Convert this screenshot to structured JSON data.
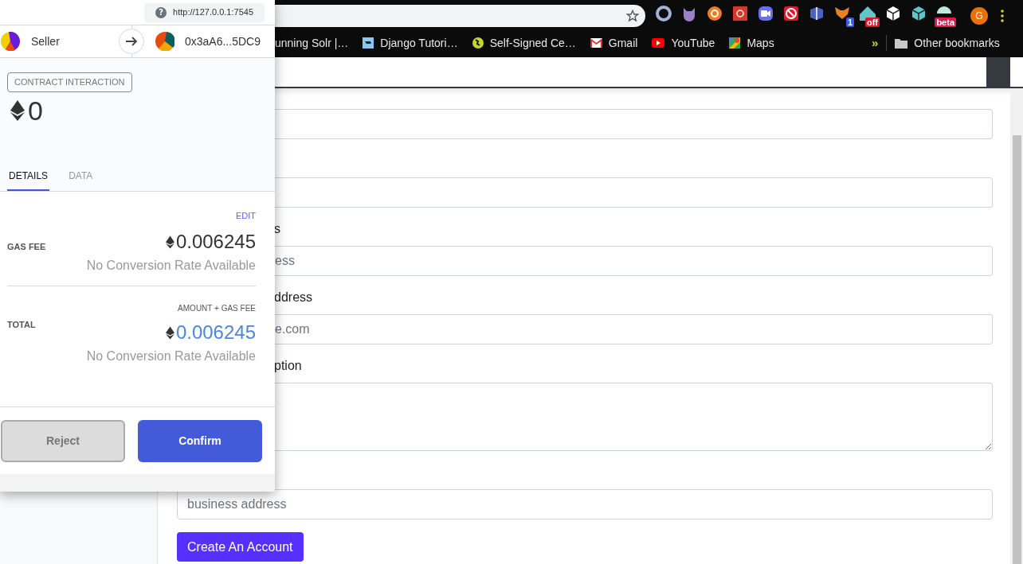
{
  "browser": {
    "bookmarks": [
      {
        "label": "unning Solr |…",
        "kind": "page"
      },
      {
        "label": "Django Tutori…",
        "kind": "django"
      },
      {
        "label": "Self-Signed Ce…",
        "kind": "globe"
      },
      {
        "label": "Gmail",
        "kind": "mail"
      },
      {
        "label": "YouTube",
        "kind": "video"
      },
      {
        "label": "Maps",
        "kind": "map"
      }
    ],
    "bookmarks_overflow": "»",
    "other_bookmarks": "Other bookmarks",
    "extensions": [
      {
        "kind": "ring",
        "color": "#9fb4d8"
      },
      {
        "kind": "cat",
        "color": "#9b7fc9"
      },
      {
        "kind": "circle",
        "color": "#f07c1a"
      },
      {
        "kind": "square",
        "color": "#d9372a"
      },
      {
        "kind": "camera",
        "color": "#6a6ff2"
      },
      {
        "kind": "block",
        "color": "#e0192a"
      },
      {
        "kind": "box",
        "color": "#4a63c0"
      },
      {
        "kind": "fox",
        "color": "#e8821e",
        "badge": "1"
      },
      {
        "kind": "ship",
        "color": "#62c6c8",
        "badge": "off"
      },
      {
        "kind": "cube",
        "color": "#ffffff"
      },
      {
        "kind": "cube",
        "color": "#5cc8cc"
      },
      {
        "kind": "dome",
        "color": "#bfe7e0",
        "badge": "beta"
      }
    ],
    "profile": "G"
  },
  "form": {
    "fields": [
      {
        "kind": "input"
      },
      {
        "kind": "input"
      },
      {
        "kind": "input",
        "label": "s",
        "placeholder": "ess"
      },
      {
        "kind": "input",
        "label": "ddress",
        "placeholder": "e.com"
      },
      {
        "kind": "textarea",
        "label": "ption"
      },
      {
        "kind": "input",
        "placeholder": "business address"
      }
    ],
    "submit": "Create An Account"
  },
  "popup": {
    "origin_icon": "?",
    "origin": "http://127.0.0.1:7545",
    "from_account": "Seller",
    "to_account": "0x3aA6...5DC9",
    "badge": "CONTRACT INTERACTION",
    "amount": "0",
    "tabs": [
      {
        "label": "DETAILS",
        "selected": true
      },
      {
        "label": "DATA",
        "selected": false
      }
    ],
    "edit_link": "EDIT",
    "gas_fee": {
      "label": "GAS FEE",
      "value": "0.006245",
      "conversion": "No Conversion Rate Available"
    },
    "total": {
      "caption": "AMOUNT + GAS FEE",
      "label": "TOTAL",
      "value": "0.006245",
      "conversion": "No Conversion Rate Available"
    },
    "buttons": [
      {
        "label": "Reject",
        "kind": "secondary"
      },
      {
        "label": "Confirm",
        "kind": "primary"
      }
    ]
  }
}
